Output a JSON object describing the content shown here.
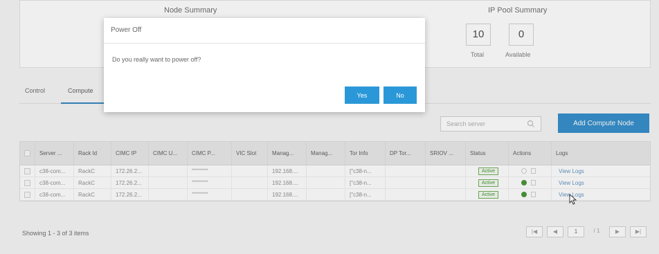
{
  "summary": {
    "node_title": "Node Summary",
    "ip_pool_title": "IP Pool Summary",
    "total_value": "10",
    "available_value": "0",
    "total_label": "Total",
    "available_label": "Available"
  },
  "tabs": [
    {
      "label": "Control"
    },
    {
      "label": "Compute"
    }
  ],
  "toolbar": {
    "search_placeholder": "Search server",
    "add_button": "Add Compute Node"
  },
  "table": {
    "headers": [
      "Server ...",
      "Rack Id",
      "CIMC IP",
      "CIMC U...",
      "CIMC P...",
      "VIC Slot",
      "Manag...",
      "Manag...",
      "Tor Info",
      "DP Tor...",
      "SRIOV ...",
      "Status",
      "Actions",
      "Logs"
    ],
    "rows": [
      {
        "server": "c38-com...",
        "rack": "RackC",
        "cimc_ip": "172.26.2...",
        "cimc_u": "",
        "cimc_p": "**********",
        "vic": "",
        "mgmt1": "192.168....",
        "mgmt2": "",
        "tor": "[\"c38-n...",
        "dp_tor": "",
        "sriov": "",
        "status": "Active",
        "logs": "View Logs"
      },
      {
        "server": "c38-com...",
        "rack": "RackC",
        "cimc_ip": "172.26.2...",
        "cimc_u": "",
        "cimc_p": "**********",
        "vic": "",
        "mgmt1": "192.168....",
        "mgmt2": "",
        "tor": "[\"c38-n...",
        "dp_tor": "",
        "sriov": "",
        "status": "Active",
        "logs": "View Logs"
      },
      {
        "server": "c38-com...",
        "rack": "RackC",
        "cimc_ip": "172.26.2...",
        "cimc_u": "",
        "cimc_p": "**********",
        "vic": "",
        "mgmt1": "192.168....",
        "mgmt2": "",
        "tor": "[\"c38-n...",
        "dp_tor": "",
        "sriov": "",
        "status": "Active",
        "logs": "View Logs"
      }
    ]
  },
  "footer": {
    "showing": "Showing 1 - 3 of 3 items",
    "page": "1",
    "of_pages": "/ 1"
  },
  "dialog": {
    "title": "Power Off",
    "message": "Do you really want to power off?",
    "yes": "Yes",
    "no": "No"
  },
  "colors": {
    "accent": "#2a88c8",
    "dialog_button": "#2a98d8",
    "active_badge": "#3c8c2c"
  }
}
